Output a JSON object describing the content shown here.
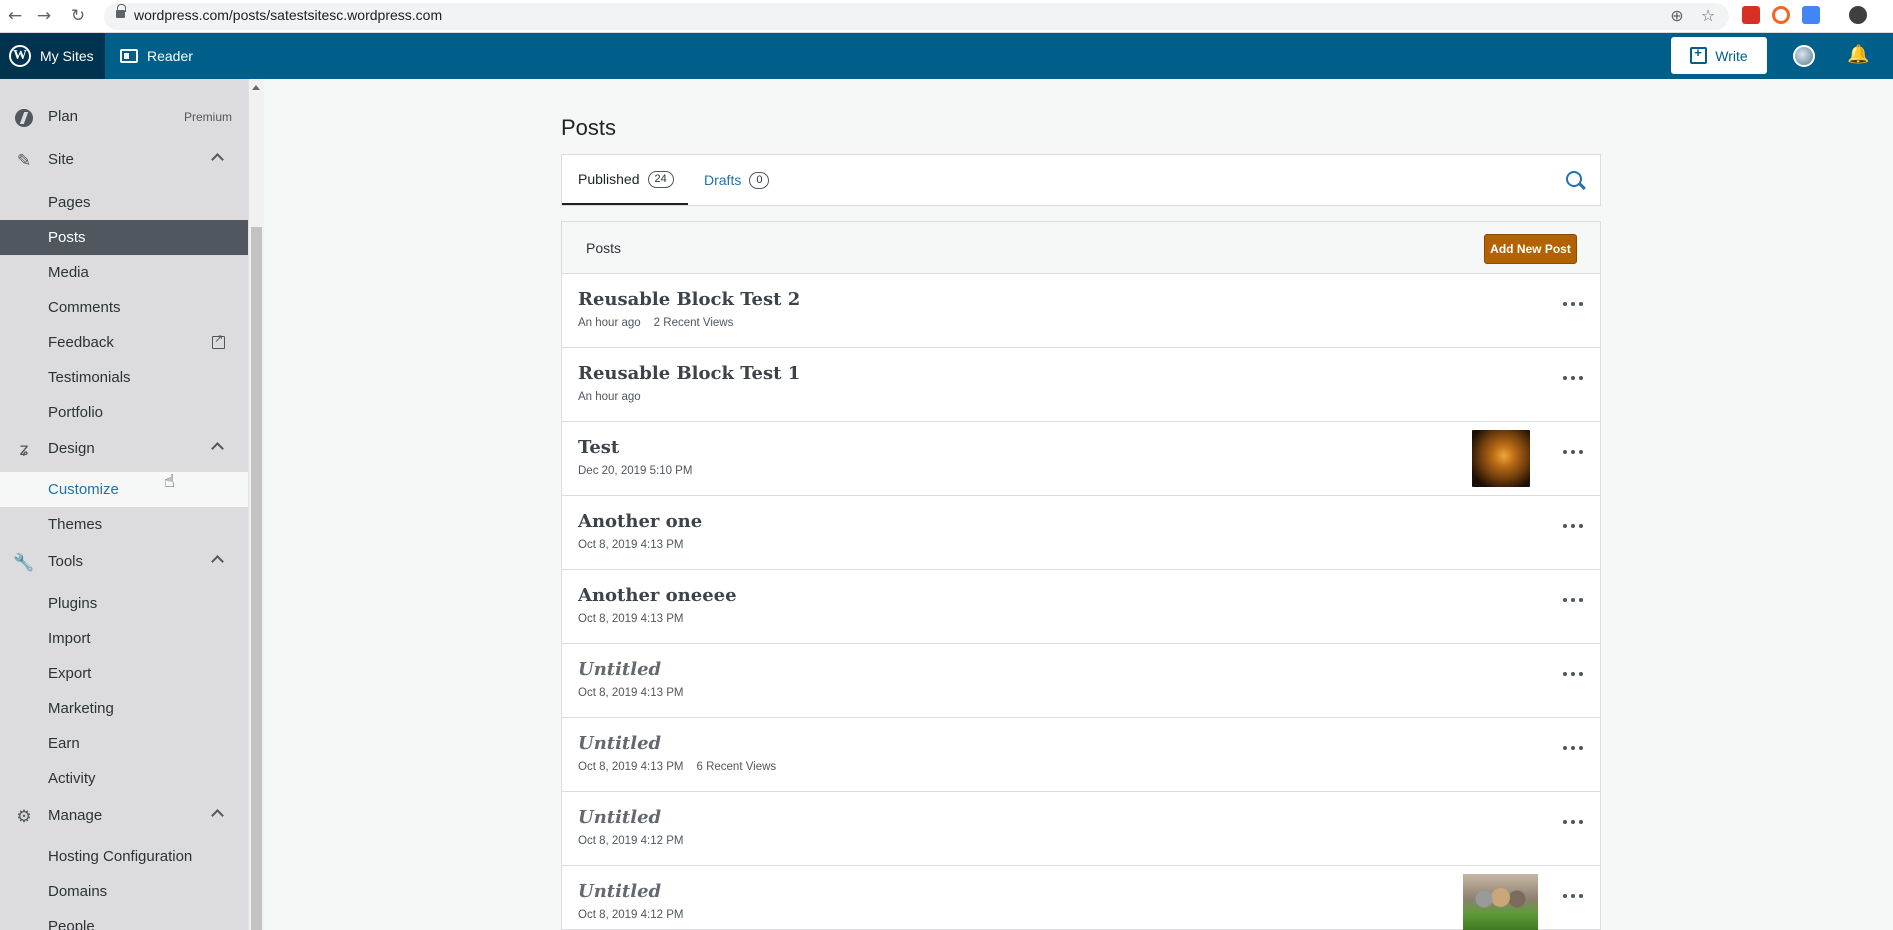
{
  "browser": {
    "url": "wordpress.com/posts/satestsitesc.wordpress.com"
  },
  "masterbar": {
    "my_sites": "My Sites",
    "reader": "Reader",
    "write": "Write"
  },
  "sidebar": {
    "plan": {
      "label": "Plan",
      "badge": "Premium"
    },
    "site": {
      "label": "Site",
      "items": [
        "Pages",
        "Posts",
        "Media",
        "Comments",
        "Feedback",
        "Testimonials",
        "Portfolio"
      ]
    },
    "design": {
      "label": "Design",
      "items": [
        "Customize",
        "Themes"
      ]
    },
    "tools": {
      "label": "Tools",
      "items": [
        "Plugins",
        "Import",
        "Export",
        "Marketing",
        "Earn",
        "Activity"
      ]
    },
    "manage": {
      "label": "Manage",
      "items": [
        "Hosting Configuration",
        "Domains",
        "People"
      ]
    }
  },
  "main": {
    "title": "Posts",
    "tabs": [
      {
        "label": "Published",
        "count": "24"
      },
      {
        "label": "Drafts",
        "count": "0"
      }
    ],
    "list_header": "Posts",
    "add_new": "Add New Post",
    "posts": [
      {
        "title": "Reusable Block Test 2",
        "date": "An hour ago",
        "views": "2 Recent Views"
      },
      {
        "title": "Reusable Block Test 1",
        "date": "An hour ago",
        "views": ""
      },
      {
        "title": "Test",
        "date": "Dec 20, 2019 5:10 PM",
        "views": ""
      },
      {
        "title": "Another one",
        "date": "Oct 8, 2019 4:13 PM",
        "views": ""
      },
      {
        "title": "Another oneeee",
        "date": "Oct 8, 2019 4:13 PM",
        "views": ""
      },
      {
        "title": "Untitled",
        "date": "Oct 8, 2019 4:13 PM",
        "views": ""
      },
      {
        "title": "Untitled",
        "date": "Oct 8, 2019 4:13 PM",
        "views": "6 Recent Views"
      },
      {
        "title": "Untitled",
        "date": "Oct 8, 2019 4:12 PM",
        "views": ""
      },
      {
        "title": "Untitled",
        "date": "Oct 8, 2019 4:12 PM",
        "views": ""
      }
    ]
  }
}
